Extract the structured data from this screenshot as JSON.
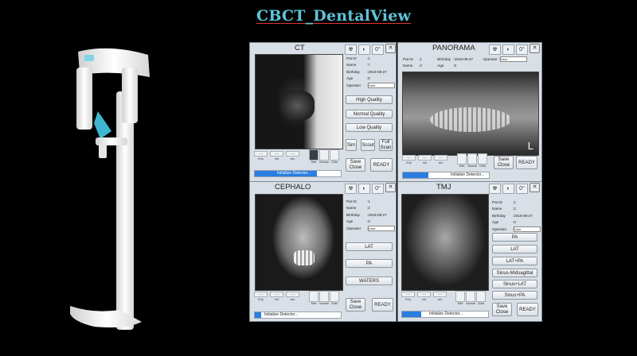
{
  "title": "CBCT_DentalView",
  "panels": {
    "ct": {
      "title": "CT",
      "info": [
        {
          "label": "Pat ID",
          "value": "1"
        },
        {
          "label": "Name",
          "value": "7"
        },
        {
          "label": "Birthday",
          "value": "2018-08-27"
        },
        {
          "label": "Age",
          "value": "0"
        },
        {
          "label": "Operator",
          "value": "User"
        }
      ],
      "buttons": {
        "high": "High Quality",
        "normal": "Normal Quality",
        "low": "Low Quality",
        "sim": "Sim",
        "scout": "Scout",
        "full_scan_1": "Full",
        "full_scan_2": "Scan",
        "save": "Save",
        "close": "Close",
        "ready": "READY"
      },
      "controls": [
        {
          "top": "-----",
          "label": "KVp"
        },
        {
          "top": "-----",
          "label": "mA"
        },
        {
          "top": "-----",
          "label": "sec"
        }
      ],
      "modes": [
        "Mini",
        "Normal",
        "Child"
      ],
      "status": "Initialize Detector..."
    },
    "pano": {
      "title": "PANORAMA",
      "info": [
        {
          "label": "Pat ID",
          "value": "1"
        },
        {
          "label": "Birthday",
          "value": "2018-08-27"
        },
        {
          "label": "Operator",
          "value": "User"
        },
        {
          "label": "Name",
          "value": "2"
        },
        {
          "label": "Age",
          "value": "0"
        }
      ],
      "l_marker": "L",
      "buttons": {
        "save": "Save",
        "close": "Close",
        "ready": "READY"
      },
      "controls": [
        {
          "top": "-----",
          "label": "KVp"
        },
        {
          "top": "-----",
          "label": "mA"
        },
        {
          "top": "-----",
          "label": "sec"
        }
      ],
      "modes": [
        "Mini",
        "Normal",
        "Child"
      ],
      "status": "Initialize Detector..."
    },
    "ceph": {
      "title": "CEPHALO",
      "info": [
        {
          "label": "Pat ID",
          "value": "1"
        },
        {
          "label": "Name",
          "value": "2"
        },
        {
          "label": "Birthday",
          "value": "2018-08-27"
        },
        {
          "label": "Age",
          "value": "0"
        },
        {
          "label": "Operator",
          "value": "User"
        }
      ],
      "buttons": {
        "lat": "LAT",
        "pa": "PA",
        "waters": "WATERS",
        "save": "Save",
        "close": "Close",
        "ready": "READY"
      },
      "controls": [
        {
          "top": "-----",
          "label": "KVp"
        },
        {
          "top": "-----",
          "label": "mA"
        },
        {
          "top": "-----",
          "label": "sec"
        }
      ],
      "modes": [
        "Mini",
        "Normal",
        "Child"
      ],
      "status": "Initialize Detector..."
    },
    "tmj": {
      "title": "TMJ",
      "info": [
        {
          "label": "Pat ID",
          "value": "1"
        },
        {
          "label": "Name",
          "value": "2"
        },
        {
          "label": "Birthday",
          "value": "2018-08-27"
        },
        {
          "label": "Age",
          "value": "0"
        },
        {
          "label": "Operator",
          "value": "User"
        }
      ],
      "buttons": {
        "pa": "PA",
        "lat": "LAT",
        "lat_pa": "LAT+PA",
        "sinus_mid": "Sinus-Midsagittal",
        "sinus_lat": "Sinus+LAT",
        "sinus_pa": "Sinus+PA",
        "save": "Save",
        "close": "Close",
        "ready": "READY"
      },
      "controls": [
        {
          "top": "-----",
          "label": "KVp"
        },
        {
          "top": "-----",
          "label": "mA"
        },
        {
          "top": "-----",
          "label": "sec"
        }
      ],
      "modes": [
        "Mini",
        "Normal",
        "Child"
      ],
      "status": "Initialize Detector..."
    }
  },
  "icons": [
    "radiation-icon",
    "bulb-icon",
    "degree-icon"
  ],
  "colors": {
    "title": "#5fc4d8",
    "status_bar": "#2a7de1",
    "panel_bg": "#d9dfe6"
  }
}
